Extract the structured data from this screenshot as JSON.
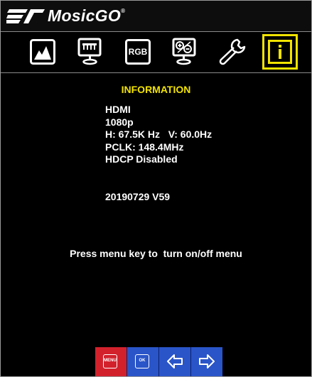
{
  "brand": {
    "name": "MosicGO",
    "reg_mark": "®"
  },
  "toolbar": {
    "items": [
      {
        "name": "picture-icon"
      },
      {
        "name": "display-settings-icon"
      },
      {
        "name": "rgb-icon",
        "label": "RGB"
      },
      {
        "name": "zoom-icon"
      },
      {
        "name": "wrench-icon"
      },
      {
        "name": "info-icon",
        "selected": true
      }
    ],
    "selected_color": "#f2e300"
  },
  "panel": {
    "title": "INFORMATION",
    "input": "HDMI",
    "resolution": "1080p",
    "frequency": "H: 67.5K Hz   V: 60.0Hz",
    "pclk": "PCLK: 148.4MHz",
    "hdcp": "HDCP Disabled",
    "version": "20190729 V59",
    "hint": "Press menu key to  turn on/off menu"
  },
  "keys": {
    "menu_label": "MENU",
    "ok_label": "OK",
    "items": [
      {
        "name": "menu-key",
        "color": "#d3212c"
      },
      {
        "name": "ok-key",
        "color": "#2a55c9"
      },
      {
        "name": "left-arrow-key",
        "color": "#2a55c9"
      },
      {
        "name": "right-arrow-key",
        "color": "#2a55c9"
      }
    ]
  }
}
